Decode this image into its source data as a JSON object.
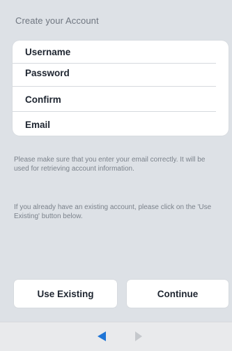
{
  "header": {
    "title": "Create your Account"
  },
  "form": {
    "fields": [
      {
        "label": "Username"
      },
      {
        "label": "Password"
      },
      {
        "label": "Confirm"
      },
      {
        "label": "Email"
      }
    ]
  },
  "info": {
    "paragraph1": "Please make sure that you enter your email correctly. It will be used for retrieving account information.",
    "paragraph2": "If you already have an existing account, please click on the 'Use Existing' button below."
  },
  "actions": {
    "use_existing_label": "Use Existing",
    "continue_label": "Continue"
  },
  "navigation": {
    "back_icon": "left-triangle-arrow",
    "forward_icon": "right-triangle-arrow",
    "active_color": "#1f75d6",
    "inactive_color": "#c5c8cc"
  },
  "colors": {
    "background": "#dde1e6",
    "card": "#ffffff"
  }
}
